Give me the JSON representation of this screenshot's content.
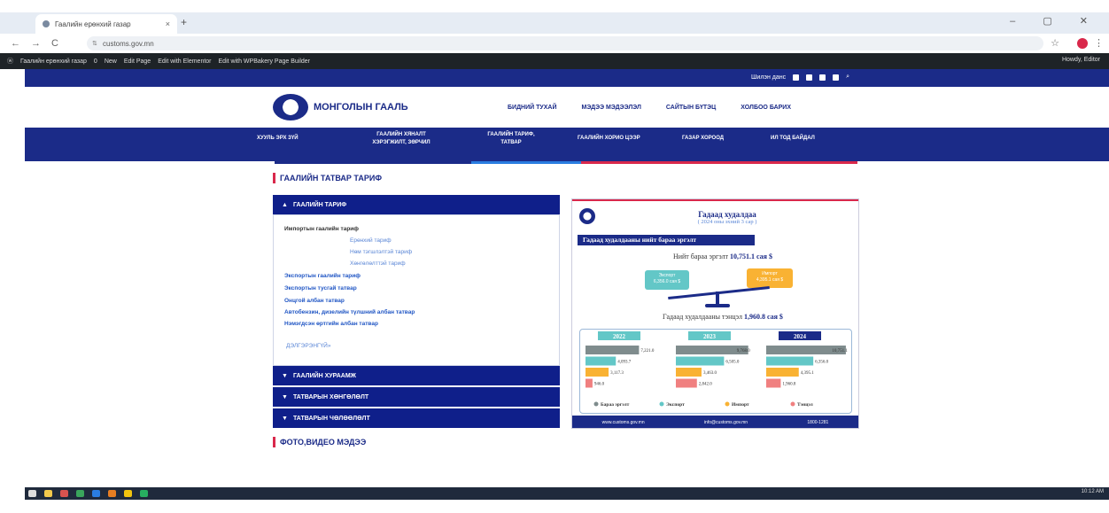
{
  "browser": {
    "tab_title": "Гаалийн ерөнхий газар",
    "tab_close": "×",
    "new_tab": "+",
    "window_controls": "– ▢ ✕",
    "back": "←",
    "forward": "→",
    "reload": "C",
    "site_info": "⇅",
    "url": "customs.gov.mn",
    "star": "☆",
    "kebab": "⋮"
  },
  "admin_bar": {
    "site_name": "Гаалийн ерөнхий газар",
    "comments": "0",
    "new": "New",
    "edit_page": "Edit Page",
    "elementor": "Edit with Elementor",
    "wpbakery": "Edit with WPBakery Page Builder",
    "howdy": "Howdy, Editor"
  },
  "top_strip": {
    "feedback": "Шилэн данс",
    "search_icon": "search-icon"
  },
  "header": {
    "logo_text": "МОНГОЛЫН ГААЛЬ",
    "nav": [
      "БИДНИЙ ТУХАЙ",
      "МЭДЭЭ МЭДЭЭЛЭЛ",
      "САЙТЫН БҮТЭЦ",
      "ХОЛБОО БАРИХ"
    ]
  },
  "subnav": {
    "items": [
      "ХУУЛЬ ЭРХ ЗҮЙ",
      "ГААЛИЙН ХЯНАЛТ\nХЭРЭГЖИЛТ, ЗӨРЧИЛ",
      "ГААЛИЙН ТАРИФ,\nТАТВАР",
      "ГААЛИЙН ХОРИО ЦЭЭР",
      "ГАЗАР ХОРООД",
      "ИЛ ТОД БАЙДАЛ"
    ]
  },
  "content": {
    "section_title": "ГААЛИЙН ТАТВАР ТАРИФ",
    "accordion_open": "ГААЛИЙН ТАРИФ",
    "body_lines": [
      "Импортын гаалийн тариф",
      "Ерөнхий тариф",
      "Нөм тэгшлэлтэй тариф",
      "Хөнгөлөлттэй тариф",
      "Экспортын гаалийн тариф",
      "Экспортын тусгай татвар",
      "Онцгой албан татвар",
      "Автобензин, дизелийн түлшний албан татвар",
      "Нэмэгдсэн өртгийн албан татвар"
    ],
    "more_link": "ДЭЛГЭРЭНГҮЙ»",
    "accordion_closed": [
      "ГААЛИЙН ХУРААМЖ",
      "ТАТВАРЫН ХӨНГӨЛӨЛТ",
      "ТАТВАРЫН ЧӨЛӨӨЛӨЛТ"
    ],
    "section_title_2": "ФОТО,ВИДЕО МЭДЭЭ"
  },
  "infographic": {
    "title": "Гадаад худалдаа",
    "subtitle": "( 2024 оны эхний 3 сар )",
    "band": "Гадаад худалдааны нийт бараа эргэлт",
    "total_label": "Нийт бараа эргэлт",
    "total_value": "10,751.1 сая $",
    "export_label": "Экспорт",
    "export_value": "6,356.0 сая $",
    "import_label": "Импорт",
    "import_value": "4,395.1 сая $",
    "balance_label": "Гадаад худалдааны тэнцэл",
    "balance_value": "1,960.8 сая $",
    "colors": {
      "total": "#7f8c8d",
      "export": "#63c7c7",
      "import": "#f9b233",
      "balance": "#f08080",
      "navy": "#1b2b88"
    },
    "footer": [
      "www.customs.gov.mn",
      "info@customs.gov.mn",
      "1800-1281"
    ]
  },
  "chart_data": {
    "type": "bar",
    "categories": [
      "2022",
      "2023",
      "2024"
    ],
    "series": [
      {
        "name": "Бараа эргэлт",
        "values": [
          7221.0,
          9768.0,
          10751.1
        ]
      },
      {
        "name": "Экспорт",
        "values": [
          4093.7,
          6505.0,
          6356.0
        ]
      },
      {
        "name": "Импорт",
        "values": [
          3117.3,
          3463.0,
          4395.1
        ]
      },
      {
        "name": "Тэнцэл",
        "values": [
          946.0,
          2842.0,
          1960.8
        ]
      }
    ],
    "value_labels": [
      [
        "7,221.0",
        "4,093.7",
        "3,117.3",
        "946.0"
      ],
      [
        "9,768.0",
        "6,505.0",
        "3,463.0",
        "2,842.0"
      ],
      [
        "10,751.1",
        "6,356.0",
        "4,395.1",
        "1,960.8"
      ]
    ]
  },
  "taskbar": {
    "tray_time": "10:12 AM"
  }
}
